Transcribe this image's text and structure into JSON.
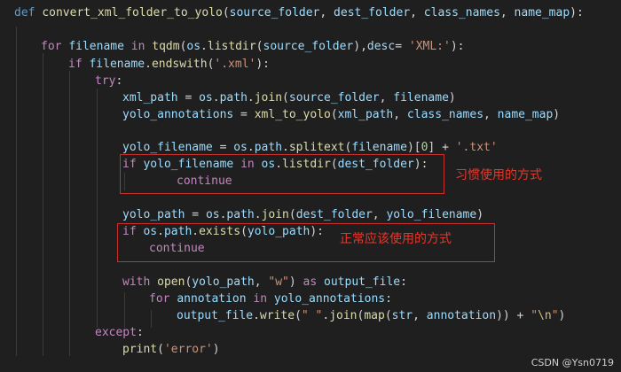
{
  "code": {
    "l1": {
      "kw": "def",
      "fn": "convert_xml_folder_to_yolo",
      "p1": "(",
      "a1": "source_folder",
      "s1": ", ",
      "a2": "dest_folder",
      "s2": ", ",
      "a3": "class_names",
      "s3": ", ",
      "a4": "name_map",
      "p2": "):"
    },
    "l2": {
      "kw": "for",
      "v1": "filename",
      "kw2": "in",
      "fn": "tqdm",
      "p1": "(",
      "v2": "os",
      "d1": ".",
      "fn2": "listdir",
      "p2": "(",
      "v3": "source_folder",
      "p3": "),",
      "v4": "desc",
      "eq": "= ",
      "str": "'XML:'",
      "p4": "):"
    },
    "l3": {
      "kw": "if",
      "v1": "filename",
      "d1": ".",
      "fn": "endswith",
      "p1": "(",
      "str": "'.xml'",
      "p2": "):"
    },
    "l4": {
      "kw": "try",
      "p": ":"
    },
    "l5": {
      "v1": "xml_path",
      "eq": " = ",
      "v2": "os",
      "d1": ".",
      "v3": "path",
      "d2": ".",
      "fn": "join",
      "p1": "(",
      "v4": "source_folder",
      "s1": ", ",
      "v5": "filename",
      "p2": ")"
    },
    "l6": {
      "v1": "yolo_annotations",
      "eq": " = ",
      "fn": "xml_to_yolo",
      "p1": "(",
      "v2": "xml_path",
      "s1": ", ",
      "v3": "class_names",
      "s2": ", ",
      "v4": "name_map",
      "p2": ")"
    },
    "l7": {
      "v1": "yolo_filename",
      "eq": " = ",
      "v2": "os",
      "d1": ".",
      "v3": "path",
      "d2": ".",
      "fn": "splitext",
      "p1": "(",
      "v4": "filename",
      "p2": ")[",
      "num": "0",
      "p3": "] + ",
      "str": "'.txt'"
    },
    "l8": {
      "kw": "if",
      "v1": "yolo_filename",
      "kw2": "in",
      "v2": "os",
      "d1": ".",
      "fn": "listdir",
      "p1": "(",
      "v3": "dest_folder",
      "p2": "):"
    },
    "l9": {
      "kw": "continue"
    },
    "l10": {
      "v1": "yolo_path",
      "eq": " = ",
      "v2": "os",
      "d1": ".",
      "v3": "path",
      "d2": ".",
      "fn": "join",
      "p1": "(",
      "v4": "dest_folder",
      "s1": ", ",
      "v5": "yolo_filename",
      "p2": ")"
    },
    "l11": {
      "kw": "if",
      "v1": "os",
      "d1": ".",
      "v2": "path",
      "d2": ".",
      "fn": "exists",
      "p1": "(",
      "v3": "yolo_path",
      "p2": "):"
    },
    "l12": {
      "kw": "continue"
    },
    "l13": {
      "kw": "with",
      "fn": "open",
      "p1": "(",
      "v1": "yolo_path",
      "s1": ", ",
      "str": "\"w\"",
      "p2": ") ",
      "kw2": "as",
      "v2": "output_file",
      "p3": ":"
    },
    "l14": {
      "kw": "for",
      "v1": "annotation",
      "kw2": "in",
      "v2": "yolo_annotations",
      "p1": ":"
    },
    "l15": {
      "v1": "output_file",
      "d1": ".",
      "fn": "write",
      "p1": "(",
      "str": "\" \"",
      "d2": ".",
      "fn2": "join",
      "p2": "(",
      "fn3": "map",
      "p3": "(",
      "v2": "str",
      "s1": ", ",
      "v3": "annotation",
      "p4": ")) + ",
      "str2": "\"",
      "esc": "\\n",
      "str3": "\"",
      "p5": ")"
    },
    "l16": {
      "kw": "except",
      "p": ":"
    },
    "l17": {
      "fn": "print",
      "p1": "(",
      "str": "'error'",
      "p2": ")"
    }
  },
  "annotations": {
    "habit": "习惯使用的方式",
    "proper": "正常应该使用的方式"
  },
  "watermark": "CSDN @Ysn0719",
  "colors": {
    "background": "#1f1f1f",
    "keyword": "#569cd6",
    "control": "#c586c0",
    "function": "#dcdcaa",
    "variable": "#9cdcfe",
    "string": "#ce9178",
    "number": "#b5cea8",
    "annotation_red": "#e03a2f"
  }
}
